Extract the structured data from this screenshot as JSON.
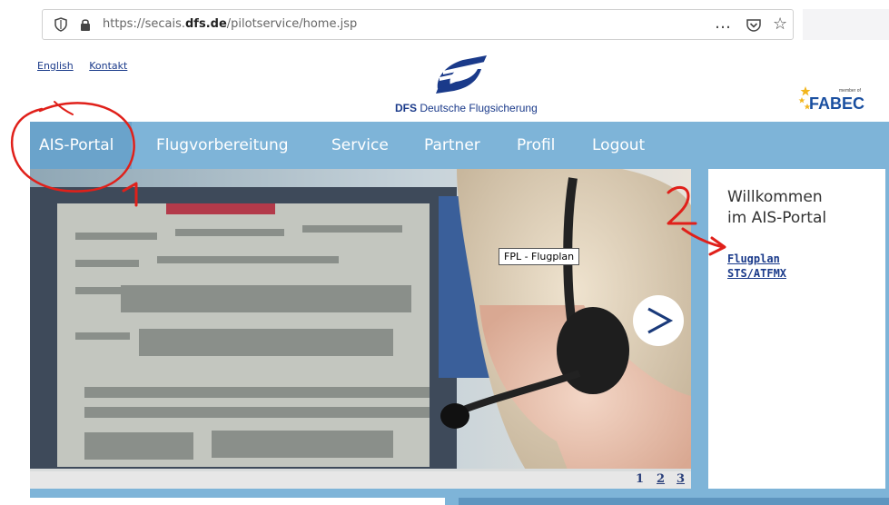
{
  "browser": {
    "url_prefix": "https://secais.",
    "url_domain": "dfs.de",
    "url_path": "/pilotservice/home.jsp",
    "more_icon": "…",
    "pocket_icon": "pocket-icon",
    "star_icon": "☆"
  },
  "header": {
    "links": [
      "English",
      "Kontakt"
    ],
    "dfs_bold": "DFS",
    "dfs_name": "Deutsche Flugsicherung",
    "fabec_member": "member of",
    "fabec_name": "FABEC"
  },
  "nav": {
    "items": [
      "AIS-Portal",
      "Flugvorbereitung",
      "Service",
      "Partner",
      "Profil",
      "Logout"
    ],
    "active": "AIS-Portal"
  },
  "hero": {
    "tooltip": "FPL - Flugplan",
    "next_icon": ">",
    "pages": [
      "1",
      "2",
      "3"
    ]
  },
  "welcome": {
    "title_line1": "Willkommen",
    "title_line2": "im AIS-Portal",
    "links": [
      "Flugplan",
      "STS/ATFMX"
    ]
  },
  "annotations": {
    "label1": "1",
    "label2": "2",
    "color": "#e0201a"
  },
  "colors": {
    "band": "#7eb4d8",
    "nav_active": "#6aa3cb",
    "link": "#1a3a8a",
    "brand": "#1a4fa0"
  }
}
